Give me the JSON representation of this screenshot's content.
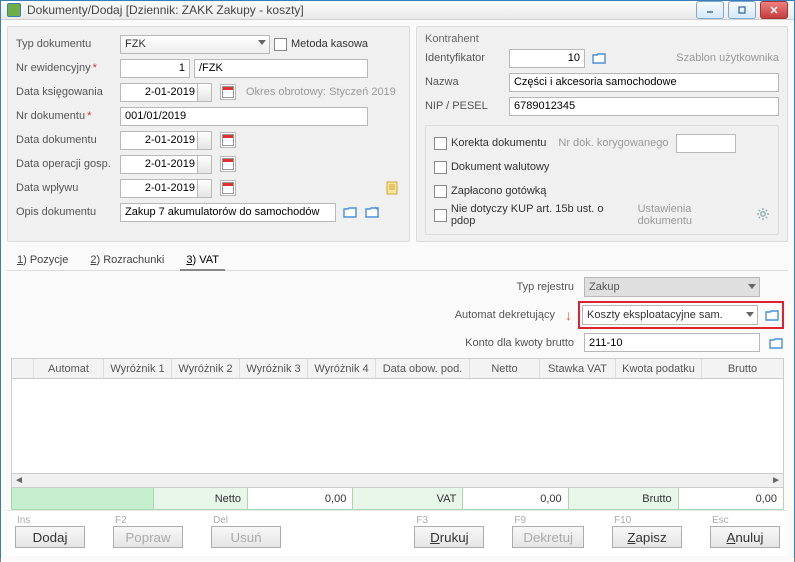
{
  "window": {
    "title": "Dokumenty/Dodaj [Dziennik: ZAKK  Zakupy - koszty]"
  },
  "left": {
    "typDokumentu_lbl": "Typ dokumentu",
    "typDokumentu_val": "FZK",
    "metodaKasowa_lbl": "Metoda kasowa",
    "nrEwidencyjny_lbl": "Nr ewidencyjny",
    "nrEwidencyjny_val": "1",
    "nrEwidencyjny_suffix": "/FZK",
    "dataKsiegowania_lbl": "Data księgowania",
    "dataKsiegowania_val": "2-01-2019",
    "okresObrotowy": "Okres obrotowy: Styczeń 2019",
    "nrDokumentu_lbl": "Nr dokumentu",
    "nrDokumentu_val": "001/01/2019",
    "dataDokumentu_lbl": "Data dokumentu",
    "dataDokumentu_val": "2-01-2019",
    "dataOperacji_lbl": "Data operacji gosp.",
    "dataOperacji_val": "2-01-2019",
    "dataWplywu_lbl": "Data wpływu",
    "dataWplywu_val": "2-01-2019",
    "opis_lbl": "Opis dokumentu",
    "opis_val": "Zakup 7 akumulatorów do samochodów"
  },
  "right": {
    "kontrahent_lbl": "Kontrahent",
    "identyfikator_lbl": "Identyfikator",
    "identyfikator_val": "10",
    "szablon": "Szablon użytkownika",
    "nazwa_lbl": "Nazwa",
    "nazwa_val": "Części i akcesoria samochodowe",
    "nip_lbl": "NIP / PESEL",
    "nip_val": "6789012345",
    "korekta_lbl": "Korekta dokumentu",
    "nrKoryg_lbl": "Nr dok. korygowanego",
    "walutowy_lbl": "Dokument walutowy",
    "gotowka_lbl": "Zapłacono gotówką",
    "kup_lbl": "Nie dotyczy KUP art. 15b ust. o pdop",
    "ustawienia": "Ustawienia dokumentu"
  },
  "tabs": {
    "t1_pre": "1",
    "t1_rest": ") Pozycje",
    "t2_pre": "2",
    "t2_rest": ") Rozrachunki",
    "t3_pre": "3",
    "t3_rest": ") VAT"
  },
  "vat": {
    "typRejestru_lbl": "Typ rejestru",
    "typRejestru_val": "Zakup",
    "automat_lbl": "Automat dekretujący",
    "automat_val": "Koszty eksploatacyjne sam.",
    "konto_lbl": "Konto dla kwoty brutto",
    "konto_val": "211-10"
  },
  "grid": {
    "cols": [
      "Automat",
      "Wyróżnik 1",
      "Wyróżnik 2",
      "Wyróżnik 3",
      "Wyróżnik 4",
      "Data obow. pod.",
      "Netto",
      "Stawka VAT",
      "Kwota podatku",
      "Brutto"
    ]
  },
  "totals": {
    "netto_lbl": "Netto",
    "netto_val": "0,00",
    "vat_lbl": "VAT",
    "vat_val": "0,00",
    "brutto_lbl": "Brutto",
    "brutto_val": "0,00"
  },
  "buttons": {
    "ins": "Ins",
    "f2": "F2",
    "del": "Del",
    "f3": "F3",
    "f9": "F9",
    "f10": "F10",
    "esc": "Esc",
    "dodaj": "Dodaj",
    "popraw": "Popraw",
    "usun": "Usuń",
    "drukuj": "Drukuj",
    "dekretuj": "Dekretuj",
    "zapisz": "Zapisz",
    "anuluj": "Anuluj"
  }
}
